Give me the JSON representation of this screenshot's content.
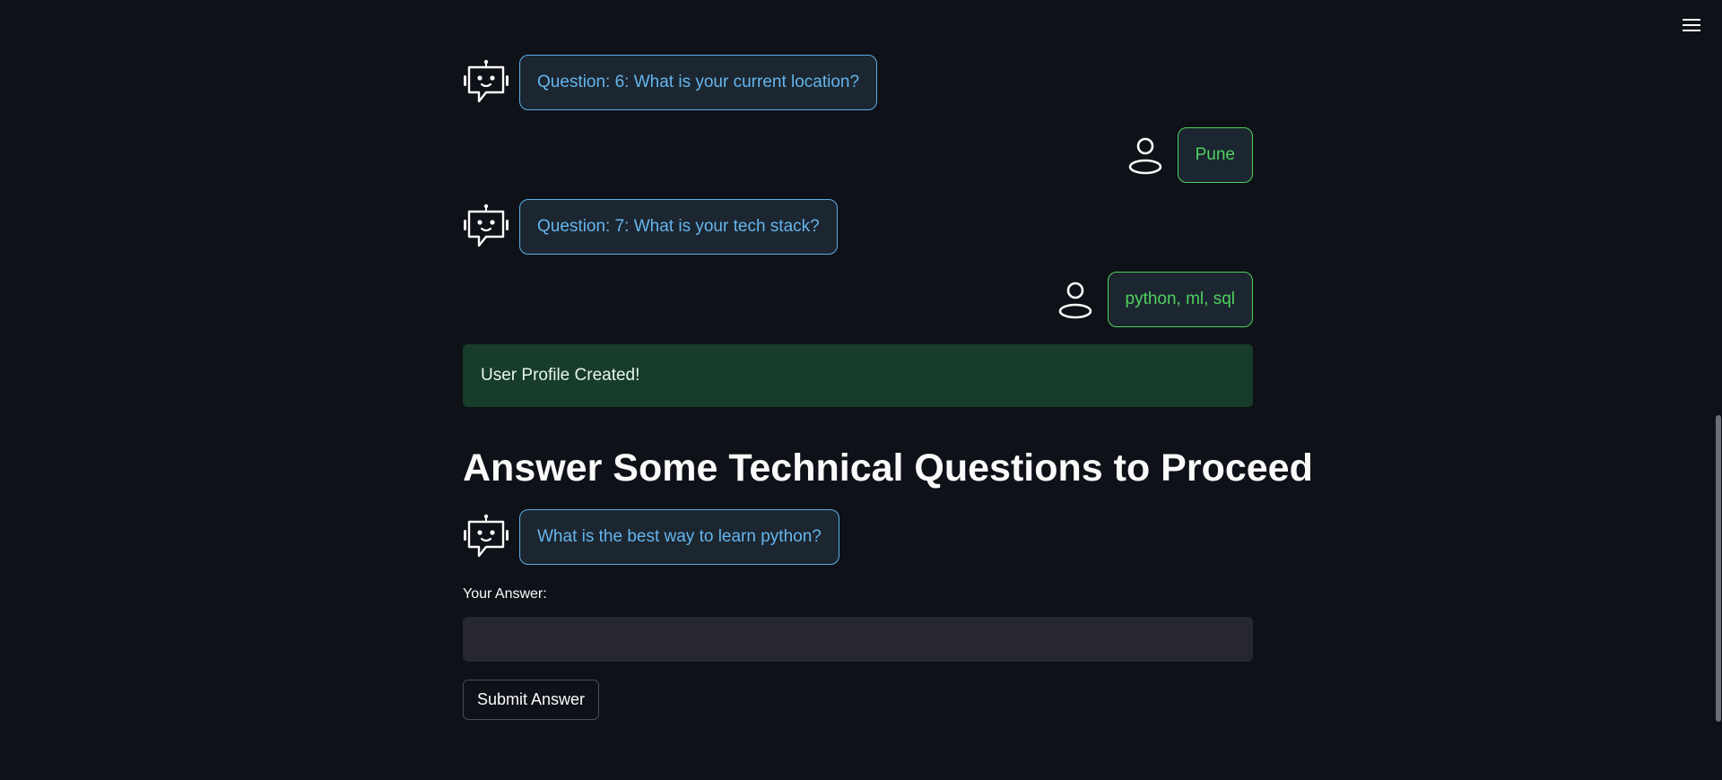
{
  "chat": {
    "bot_msg_1": "Question: 6: What is your current location?",
    "user_msg_1": "Pune",
    "bot_msg_2": "Question: 7: What is your tech stack?",
    "user_msg_2": "python, ml, sql",
    "bot_msg_3": "What is the best way to learn python?"
  },
  "status": {
    "success_text": "User Profile Created!"
  },
  "section": {
    "heading": "Answer Some Technical Questions to Proceed"
  },
  "form": {
    "answer_label": "Your Answer:",
    "answer_value": "",
    "submit_label": "Submit Answer"
  },
  "icons": {
    "menu": "hamburger-menu-icon",
    "bot": "robot-icon",
    "user": "user-icon"
  },
  "colors": {
    "background": "#0e1117",
    "bot_accent": "#64b5ee",
    "user_accent": "#4fd05f",
    "success_bg": "#183c2a"
  }
}
